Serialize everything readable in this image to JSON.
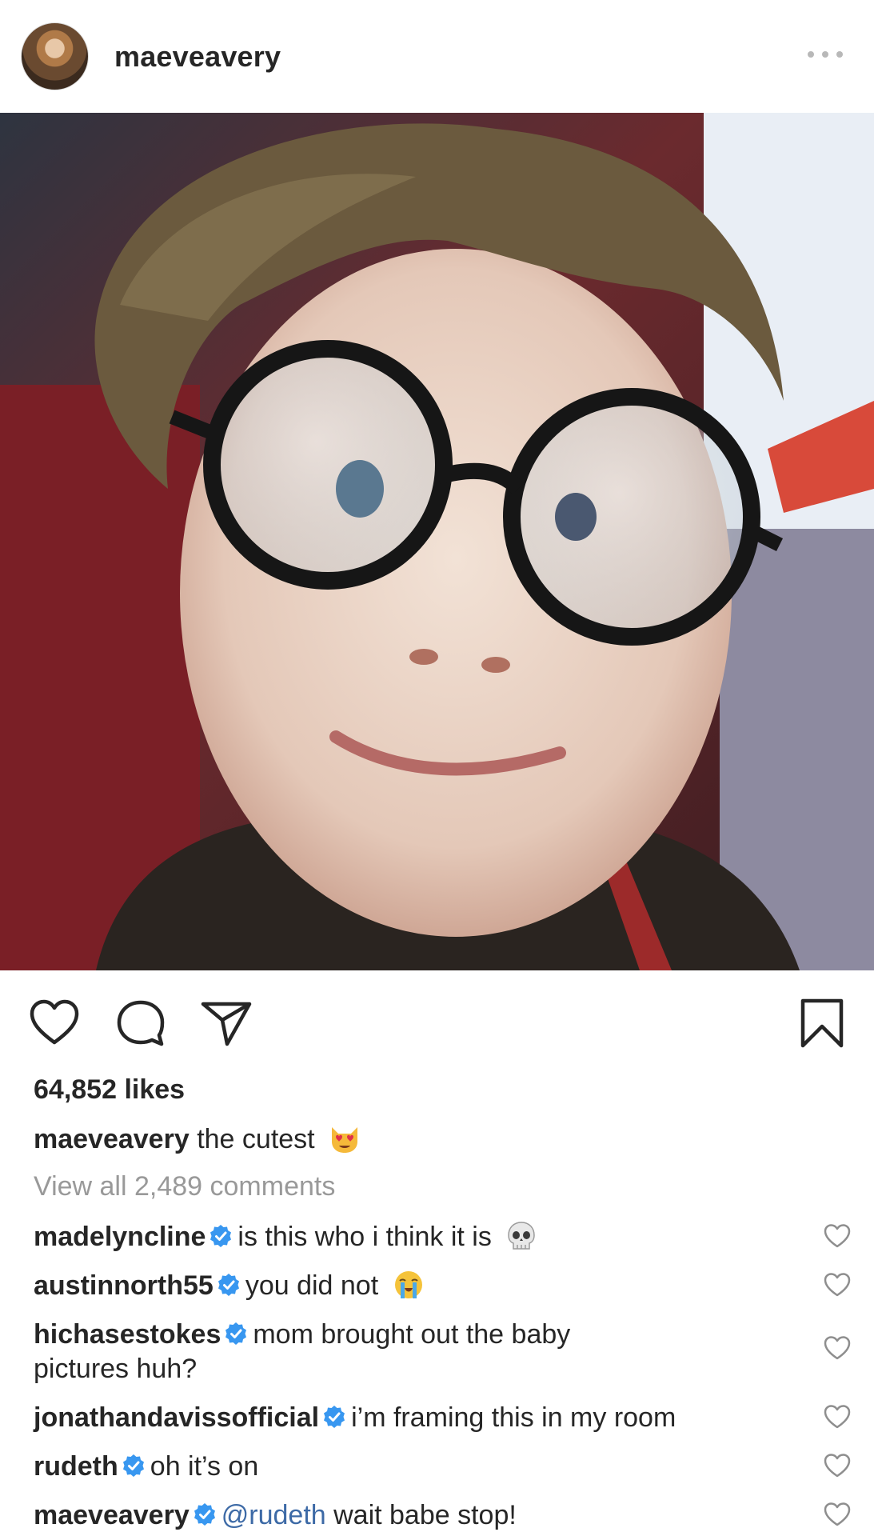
{
  "header": {
    "username": "maeveavery"
  },
  "post": {
    "likes": "64,852 likes",
    "caption": {
      "username": "maeveavery",
      "text": " the cutest",
      "emoji": "heart-eyes-cat"
    },
    "view_all_comments": "View all 2,489 comments",
    "comments": [
      {
        "username": "madelyncline",
        "text": "is this who i think it is",
        "emoji": "skull",
        "verified": true
      },
      {
        "username": "austinnorth55",
        "text": "you did not",
        "emoji": "loudly-crying-face",
        "verified": true
      },
      {
        "username": "hichasestokes",
        "text": "mom brought out the baby",
        "text2": "pictures huh?",
        "verified": true
      },
      {
        "username": "jonathandavissofficial",
        "text": "i’m framing this in my room",
        "verified": true
      },
      {
        "username": "rudeth",
        "text": "oh it’s on",
        "verified": true
      },
      {
        "username": "maeveavery",
        "mention": "@rudeth",
        "text": " wait babe stop!",
        "verified": true
      }
    ]
  },
  "colors": {
    "text": "#262626",
    "muted": "#999999",
    "verified": "#3897f0",
    "mention": "#3d6aa6"
  }
}
